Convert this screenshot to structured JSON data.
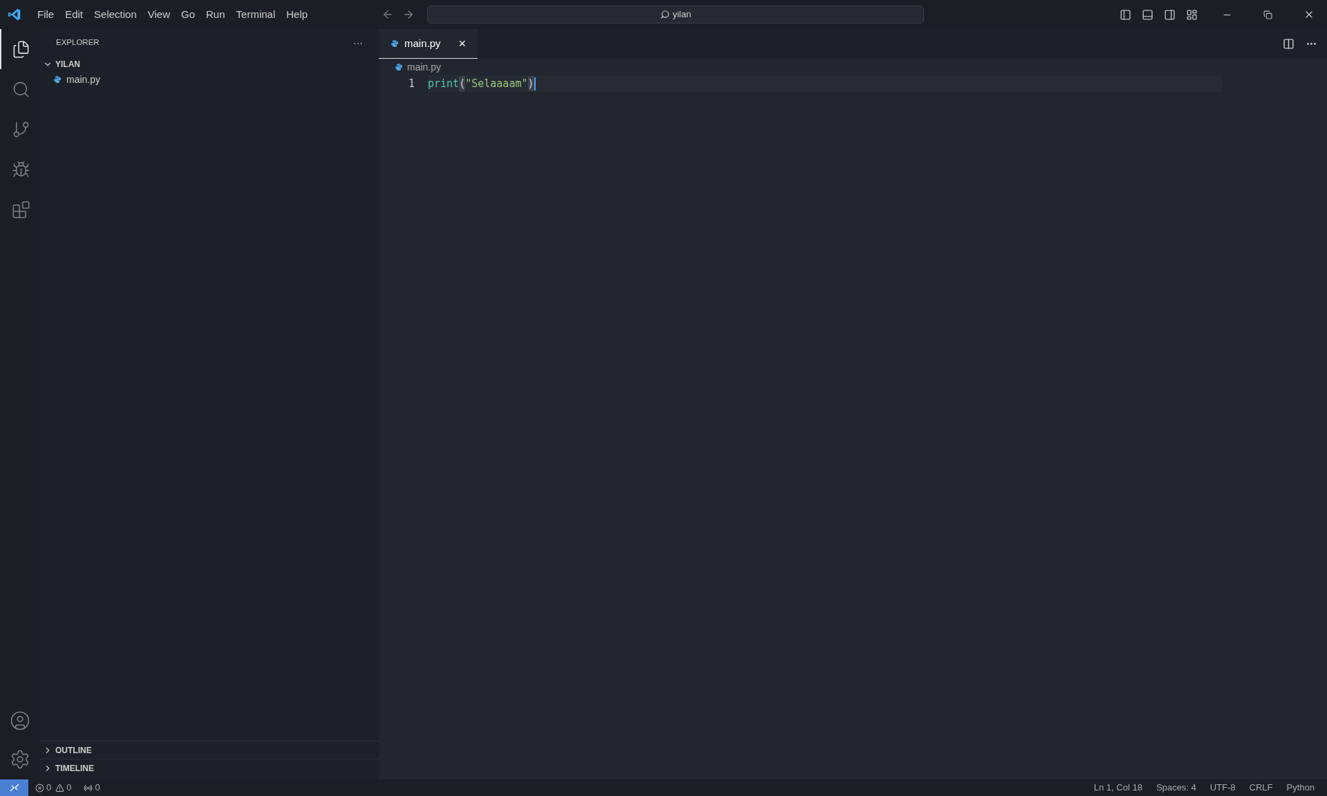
{
  "menu": [
    "File",
    "Edit",
    "Selection",
    "View",
    "Go",
    "Run",
    "Terminal",
    "Help"
  ],
  "search": {
    "value": "yilan"
  },
  "activity": [
    {
      "kind": "files",
      "selected": true
    },
    {
      "kind": "search",
      "selected": false
    },
    {
      "kind": "git",
      "selected": false
    },
    {
      "kind": "debug",
      "selected": false
    },
    {
      "kind": "extensions",
      "selected": false
    }
  ],
  "sidebar": {
    "title": "EXPLORER",
    "more": "···",
    "folder": {
      "name": "YILAN",
      "expanded": true,
      "files": [
        "main.py"
      ]
    },
    "sections": [
      {
        "name": "OUTLINE",
        "expanded": false
      },
      {
        "name": "TIMELINE",
        "expanded": false
      }
    ]
  },
  "tabs": [
    {
      "label": "main.py",
      "selected": true,
      "close": "×"
    }
  ],
  "breadcrumb": "main.py",
  "editor": {
    "lines": [
      {
        "number": "1",
        "tokens": [
          {
            "kind": "function",
            "text": "print"
          },
          {
            "kind": "bracket",
            "text": "("
          },
          {
            "kind": "string",
            "text": "\"Selaaaam\""
          },
          {
            "kind": "bracket",
            "text": ")"
          }
        ]
      }
    ]
  },
  "status": {
    "errors": "0",
    "warnings": "0",
    "ports": "0",
    "right": [
      "Ln 1, Col 18",
      "Spaces: 4",
      "UTF-8",
      "CRLF",
      "Python"
    ]
  }
}
